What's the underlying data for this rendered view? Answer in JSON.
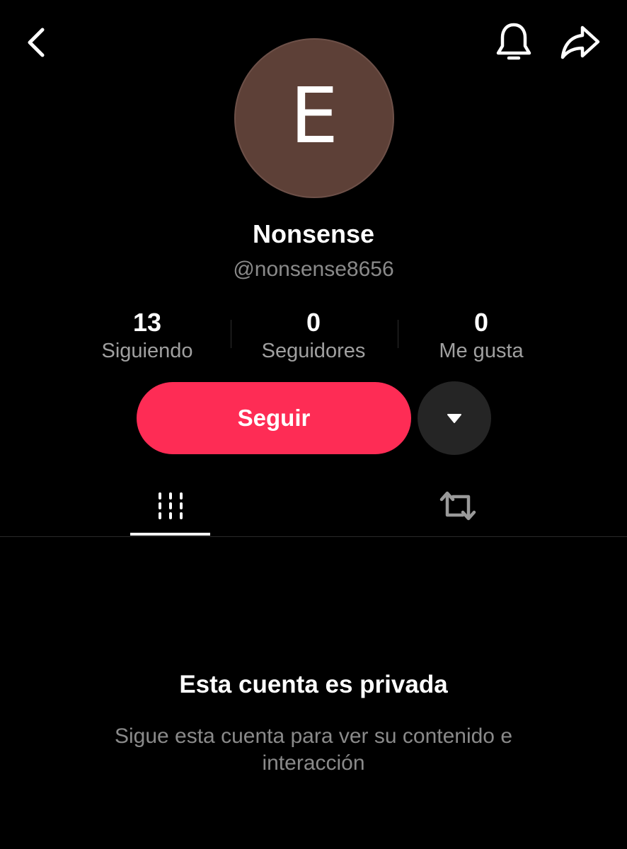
{
  "header": {
    "back_icon": "chevron-left-icon",
    "notification_icon": "bell-icon",
    "share_icon": "share-arrow-icon"
  },
  "profile": {
    "avatar_letter": "E",
    "avatar_color": "#5d4037",
    "display_name": "Nonsense",
    "username": "@nonsense8656"
  },
  "stats": [
    {
      "value": "13",
      "label": "Siguiendo"
    },
    {
      "value": "0",
      "label": "Seguidores"
    },
    {
      "value": "0",
      "label": "Me gusta"
    }
  ],
  "actions": {
    "follow_label": "Seguir",
    "follow_color": "#fe2c55",
    "more_icon": "caret-down-icon"
  },
  "tabs": [
    {
      "icon": "videos-grid-icon",
      "active": true
    },
    {
      "icon": "repost-icon",
      "active": false
    }
  ],
  "private_notice": {
    "title": "Esta cuenta es privada",
    "description": "Sigue esta cuenta para ver su contenido e interacción"
  }
}
